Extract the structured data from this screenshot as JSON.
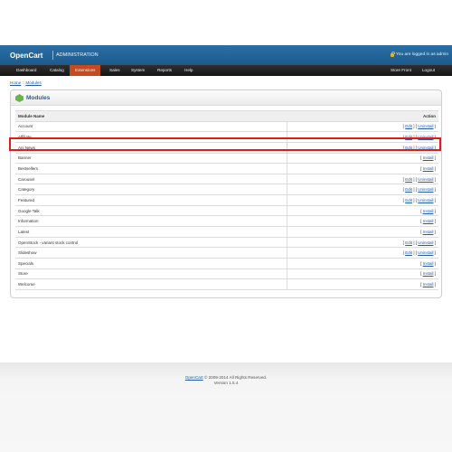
{
  "header": {
    "brand": "OpenCart",
    "subtitle": "ADMINISTRATION",
    "login_info": "You are logged in as admin"
  },
  "menu": {
    "items": [
      "Dashboard",
      "Catalog",
      "Extensions",
      "Sales",
      "System",
      "Reports",
      "Help"
    ],
    "active": "Extensions",
    "right_items": [
      "Store Front",
      "Logout"
    ]
  },
  "breadcrumb": {
    "home": "Home",
    "sep": "::",
    "current": "Modules"
  },
  "panel": {
    "title": "Modules"
  },
  "table": {
    "col_name": "Module Name",
    "col_action": "Action",
    "rows": [
      {
        "name": "Account",
        "edit": "Edit",
        "action": "Uninstall"
      },
      {
        "name": "Affiliate",
        "edit": "Edit",
        "action": "Uninstall"
      },
      {
        "name": "Ani News",
        "edit": "Edit",
        "action": "Uninstall"
      },
      {
        "name": "Banner",
        "edit": "",
        "action": "Install"
      },
      {
        "name": "Bestsellers",
        "edit": "",
        "action": "Install"
      },
      {
        "name": "Carousel",
        "edit": "Edit",
        "action": "Uninstall"
      },
      {
        "name": "Category",
        "edit": "Edit",
        "action": "Uninstall"
      },
      {
        "name": "Featured",
        "edit": "Edit",
        "action": "Uninstall"
      },
      {
        "name": "Google Talk",
        "edit": "",
        "action": "Install"
      },
      {
        "name": "Information",
        "edit": "",
        "action": "Install"
      },
      {
        "name": "Latest",
        "edit": "",
        "action": "Install"
      },
      {
        "name": "OpenStock - variant stock control",
        "edit": "Edit",
        "action": "Uninstall"
      },
      {
        "name": "Slideshow",
        "edit": "Edit",
        "action": "Uninstall"
      },
      {
        "name": "Specials",
        "edit": "",
        "action": "Install"
      },
      {
        "name": "Store",
        "edit": "",
        "action": "Install"
      },
      {
        "name": "Welcome",
        "edit": "",
        "action": "Install"
      }
    ]
  },
  "footer": {
    "link": "OpenCart",
    "copyright": "© 2009-2014 All Rights Reserved.",
    "version": "Version 1.5.4"
  },
  "colors": {
    "header_blue": "#2a6fa6",
    "menu_dark": "#1e1e1e",
    "active_menu": "#c54b1e",
    "link_blue": "#1f5ea8",
    "highlight_red": "#e11a1f"
  }
}
